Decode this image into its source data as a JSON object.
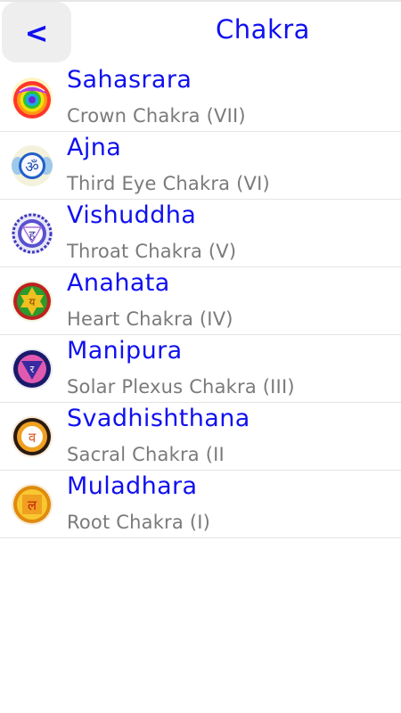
{
  "header": {
    "back_label": "<",
    "title": "Chakra"
  },
  "chakras": [
    {
      "name": "Sahasrara",
      "subtitle": "Crown Chakra (VII)",
      "icon": "sahasrara-lotus-icon",
      "color": "#b23ad6"
    },
    {
      "name": "Ajna",
      "subtitle": "Third Eye Chakra (VI)",
      "icon": "ajna-om-icon",
      "color": "#3b6fd8"
    },
    {
      "name": "Vishuddha",
      "subtitle": "Throat Chakra (V)",
      "icon": "vishuddha-ham-icon",
      "color": "#3a3fc4"
    },
    {
      "name": "Anahata",
      "subtitle": "Heart Chakra (IV)",
      "icon": "anahata-yam-icon",
      "color": "#2e9a2e"
    },
    {
      "name": "Manipura",
      "subtitle": "Solar Plexus Chakra (III)",
      "icon": "manipura-ram-icon",
      "color": "#e0a020"
    },
    {
      "name": "Svadhishthana",
      "subtitle": "Sacral Chakra (II",
      "icon": "svadhishthana-vam-icon",
      "color": "#e06a10"
    },
    {
      "name": "Muladhara",
      "subtitle": "Root Chakra (I)",
      "icon": "muladhara-lam-icon",
      "color": "#d02020"
    }
  ]
}
